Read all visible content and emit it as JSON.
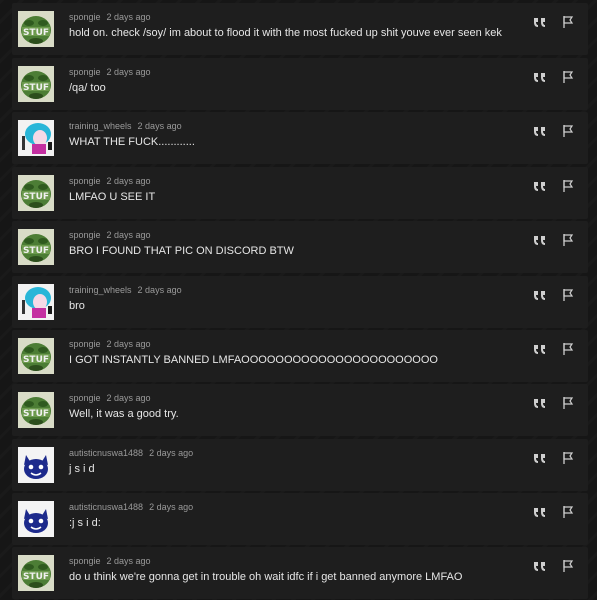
{
  "posts": [
    {
      "username": "spongie",
      "time": "2 days ago",
      "message": "hold on. check /soy/ im about to flood it with the most fucked up shit youve ever seen kek",
      "avatar": "stuf-avatar"
    },
    {
      "username": "spongie",
      "time": "2 days ago",
      "message": "/qa/ too",
      "avatar": "stuf-avatar"
    },
    {
      "username": "training_wheels",
      "time": "2 days ago",
      "message": "WHAT THE FUCK............",
      "avatar": "anime-avatar"
    },
    {
      "username": "spongie",
      "time": "2 days ago",
      "message": "LMFAO U SEE IT",
      "avatar": "stuf-avatar"
    },
    {
      "username": "spongie",
      "time": "2 days ago",
      "message": "BRO I FOUND THAT PIC ON DISCORD BTW",
      "avatar": "stuf-avatar"
    },
    {
      "username": "training_wheels",
      "time": "2 days ago",
      "message": "bro",
      "avatar": "anime-avatar"
    },
    {
      "username": "spongie",
      "time": "2 days ago",
      "message": "I GOT INSTANTLY BANNED LMFAOOOOOOOOOOOOOOOOOOOOOOO",
      "avatar": "stuf-avatar"
    },
    {
      "username": "spongie",
      "time": "2 days ago",
      "message": "Well, it was a good try.",
      "avatar": "stuf-avatar"
    },
    {
      "username": "autisticnuswa1488",
      "time": "2 days ago",
      "message": "j s i d",
      "avatar": "cat-avatar"
    },
    {
      "username": "autisticnuswa1488",
      "time": "2 days ago",
      "message": ":j s i d:",
      "avatar": "cat-avatar"
    },
    {
      "username": "spongie",
      "time": "2 days ago",
      "message": "do u think we're gonna get in trouble oh wait idfc if i get banned anymore LMFAO",
      "avatar": "stuf-avatar"
    }
  ],
  "icons": {
    "quote": "quote-icon",
    "flag": "flag-icon"
  },
  "colors": {
    "background": "#161616",
    "post_background": "#1e1e1e",
    "meta_text": "#9a9a9a",
    "message_text": "#e6e6e6"
  }
}
